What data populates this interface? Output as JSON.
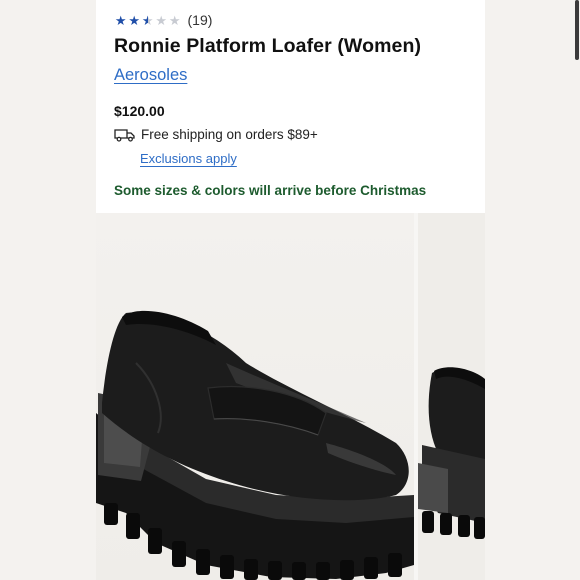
{
  "product": {
    "rating_stars": 3,
    "rating_max": 5,
    "review_count": "(19)",
    "title": "Ronnie Platform Loafer (Women)",
    "brand": "Aerosoles",
    "price": "$120.00",
    "shipping_text": "Free shipping on orders $89+",
    "exclusions_link": "Exclusions apply",
    "holiday_notice": "Some sizes & colors will arrive before Christmas"
  },
  "icons": {
    "star": "star-icon",
    "truck": "truck-icon"
  },
  "colors": {
    "link": "#2e6dc6",
    "star_filled": "#1f4ea8",
    "notice": "#1d5b2e"
  }
}
